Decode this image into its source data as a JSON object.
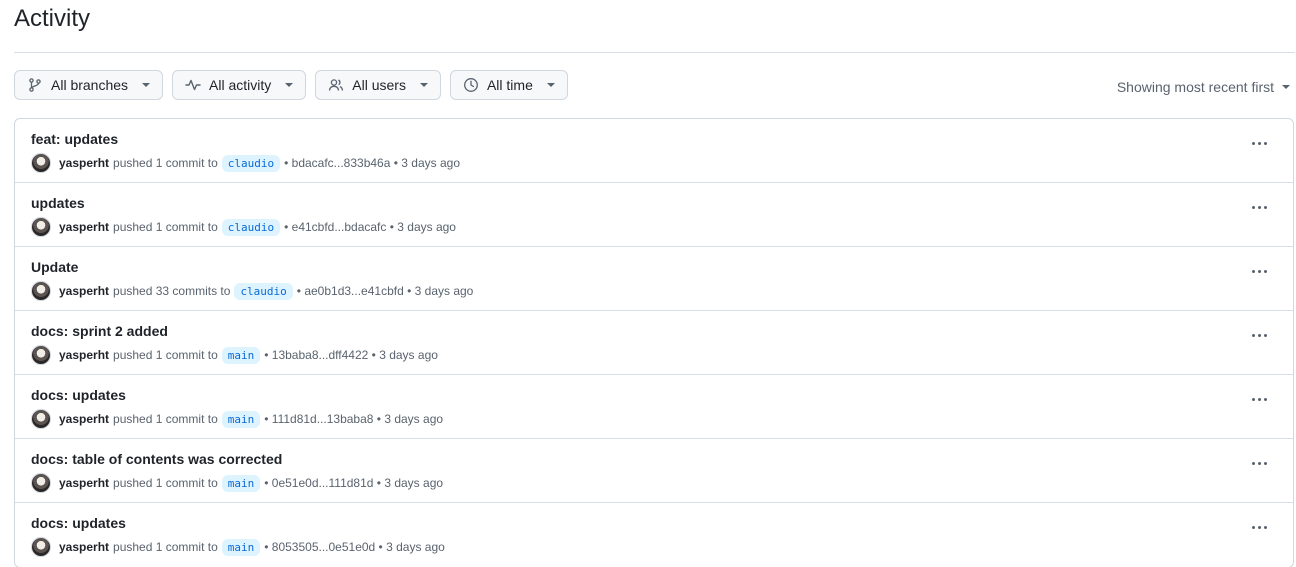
{
  "page": {
    "title": "Activity"
  },
  "filters": {
    "branches": "All branches",
    "activity": "All activity",
    "users": "All users",
    "time": "All time"
  },
  "sort": {
    "label": "Showing most recent first"
  },
  "items": [
    {
      "title": "feat: updates",
      "user": "yasperht",
      "action": "pushed 1 commit to",
      "branch": "claudio",
      "range": "• bdacafc...833b46a •",
      "time": "3 days ago"
    },
    {
      "title": "updates",
      "user": "yasperht",
      "action": "pushed 1 commit to",
      "branch": "claudio",
      "range": "• e41cbfd...bdacafc •",
      "time": "3 days ago"
    },
    {
      "title": "Update",
      "user": "yasperht",
      "action": "pushed 33 commits to",
      "branch": "claudio",
      "range": "• ae0b1d3...e41cbfd •",
      "time": "3 days ago"
    },
    {
      "title": "docs: sprint 2 added",
      "user": "yasperht",
      "action": "pushed 1 commit to",
      "branch": "main",
      "range": "• 13baba8...dff4422 •",
      "time": "3 days ago"
    },
    {
      "title": "docs: updates",
      "user": "yasperht",
      "action": "pushed 1 commit to",
      "branch": "main",
      "range": "• 111d81d...13baba8 •",
      "time": "3 days ago"
    },
    {
      "title": "docs: table of contents was corrected",
      "user": "yasperht",
      "action": "pushed 1 commit to",
      "branch": "main",
      "range": "• 0e51e0d...111d81d •",
      "time": "3 days ago"
    },
    {
      "title": "docs: updates",
      "user": "yasperht",
      "action": "pushed 1 commit to",
      "branch": "main",
      "range": "• 8053505...0e51e0d •",
      "time": "3 days ago"
    }
  ]
}
